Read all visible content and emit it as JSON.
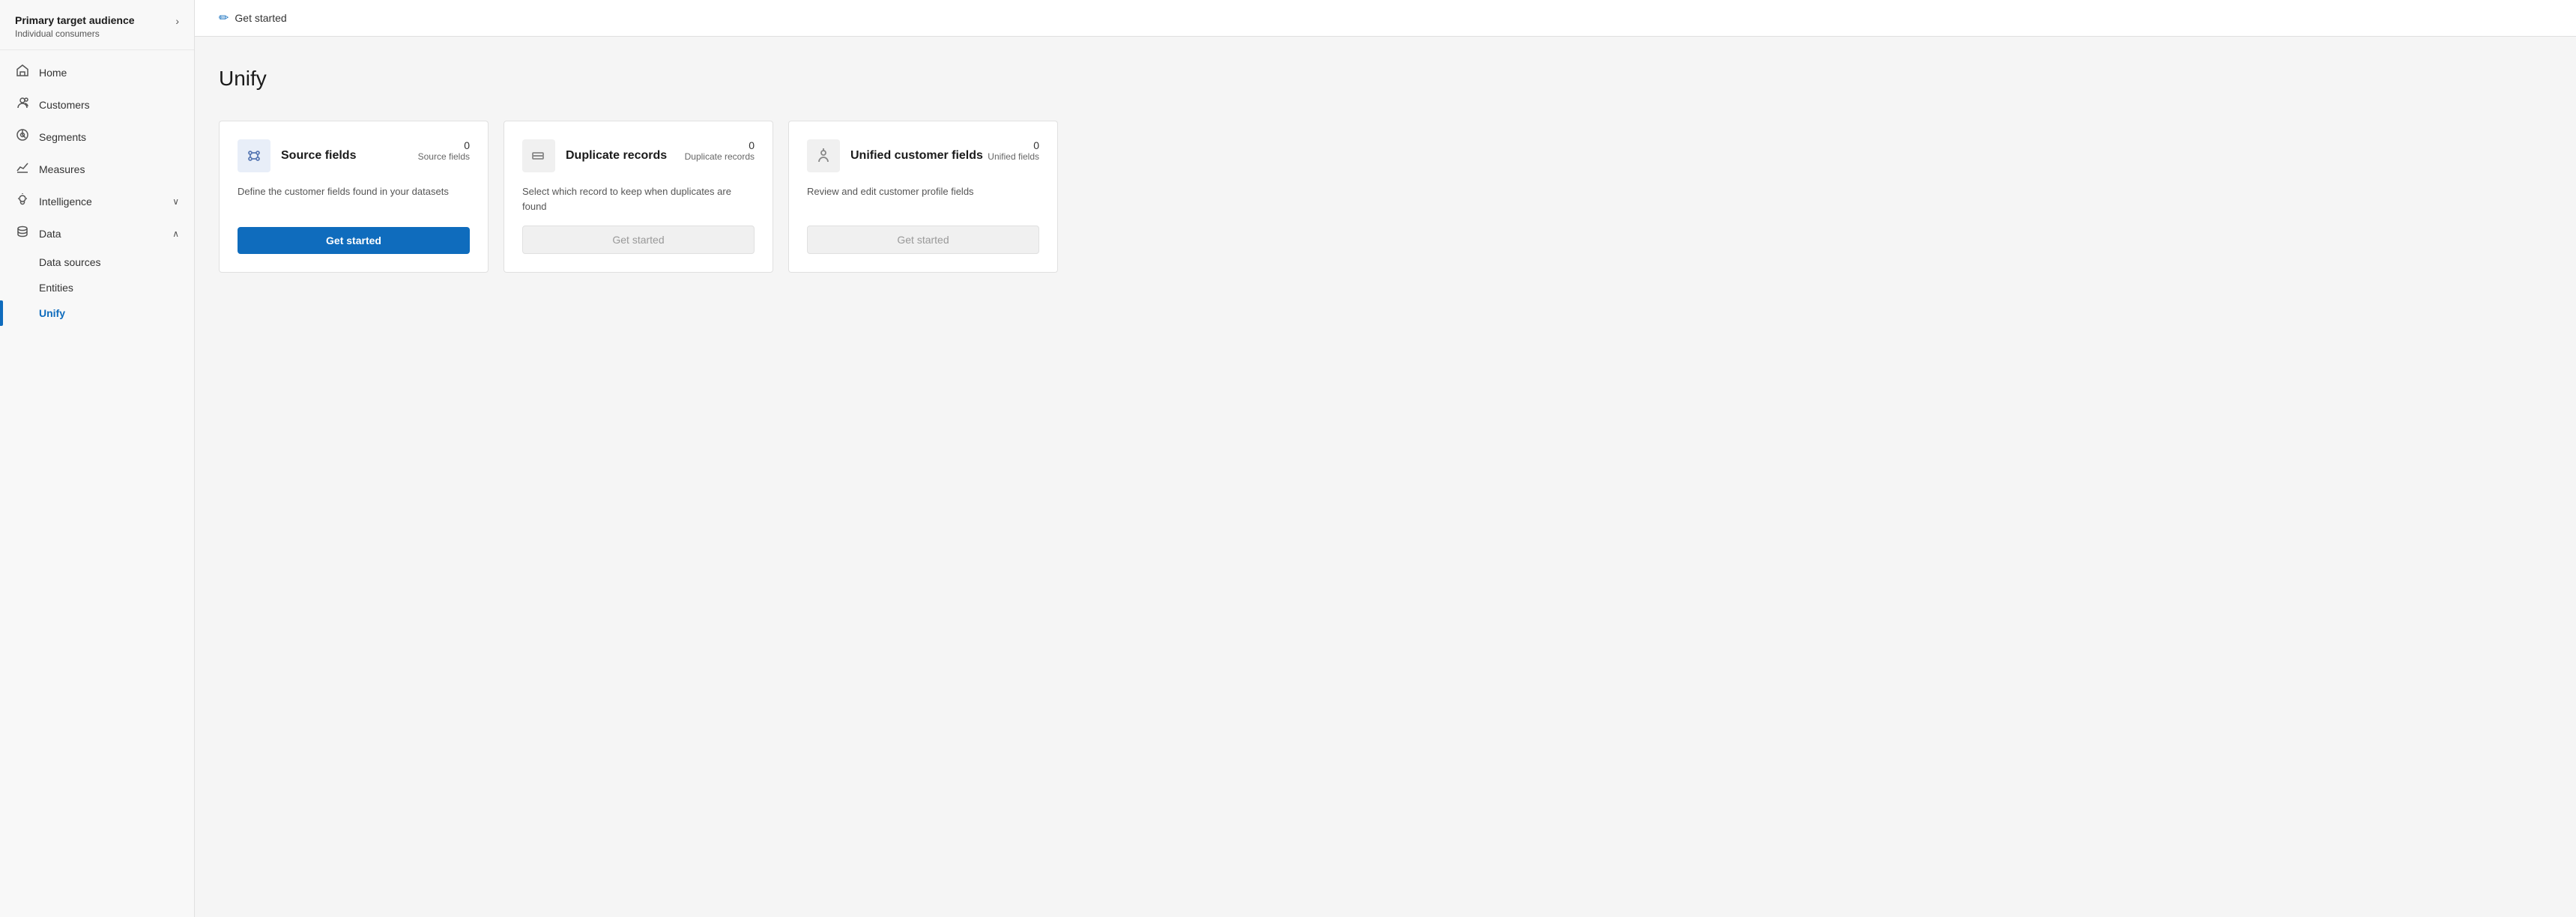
{
  "sidebar": {
    "header": {
      "title": "Primary target audience",
      "subtitle": "Individual consumers",
      "chevron": "›"
    },
    "nav_items": [
      {
        "id": "home",
        "label": "Home",
        "icon": "🏠",
        "active": false,
        "expandable": false
      },
      {
        "id": "customers",
        "label": "Customers",
        "icon": "👥",
        "active": false,
        "expandable": false
      },
      {
        "id": "segments",
        "label": "Segments",
        "icon": "🎯",
        "active": false,
        "expandable": false
      },
      {
        "id": "measures",
        "label": "Measures",
        "icon": "📈",
        "active": false,
        "expandable": false
      },
      {
        "id": "intelligence",
        "label": "Intelligence",
        "icon": "💡",
        "active": false,
        "expandable": true,
        "expand_icon": "∨"
      },
      {
        "id": "data",
        "label": "Data",
        "icon": "🗄",
        "active": false,
        "expandable": true,
        "expand_icon": "∧",
        "expanded": true
      }
    ],
    "sub_items": [
      {
        "id": "data-sources",
        "label": "Data sources",
        "active": false
      },
      {
        "id": "entities",
        "label": "Entities",
        "active": false
      },
      {
        "id": "unify",
        "label": "Unify",
        "active": true
      }
    ]
  },
  "main": {
    "header": {
      "icon": "✏",
      "title": "Get started"
    },
    "page_title": "Unify",
    "cards": [
      {
        "id": "source-fields",
        "title": "Source fields",
        "count": "0",
        "count_label": "Source fields",
        "description": "Define the customer fields found in your datasets",
        "button_label": "Get started",
        "button_enabled": true,
        "icon_type": "blue"
      },
      {
        "id": "duplicate-records",
        "title": "Duplicate records",
        "count": "0",
        "count_label": "Duplicate records",
        "description": "Select which record to keep when duplicates are found",
        "button_label": "Get started",
        "button_enabled": false,
        "icon_type": "gray"
      },
      {
        "id": "unified-customer-fields",
        "title": "Unified customer fields",
        "count": "0",
        "count_label": "Unified fields",
        "description": "Review and edit customer profile fields",
        "button_label": "Get started",
        "button_enabled": false,
        "icon_type": "gray"
      }
    ]
  }
}
